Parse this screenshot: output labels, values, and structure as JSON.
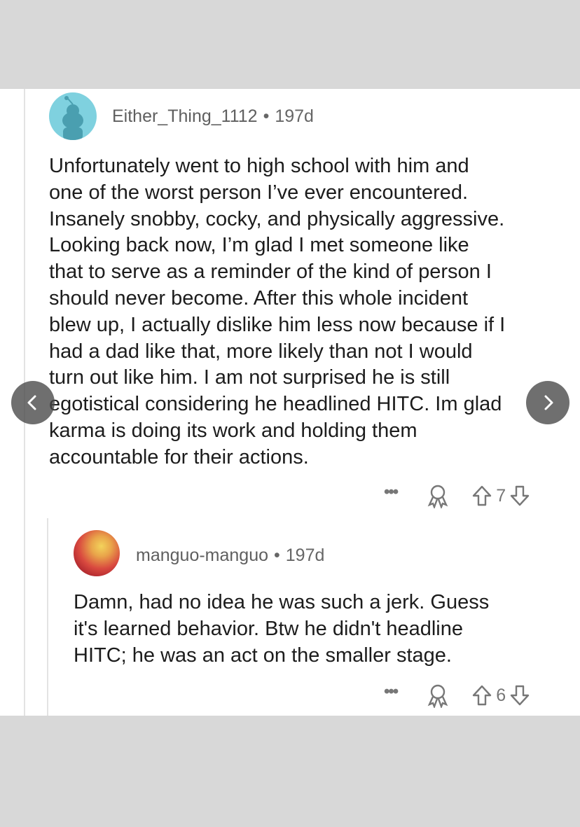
{
  "comments": [
    {
      "username": "Either_Thing_1112",
      "separator": "•",
      "age": "197d",
      "body": "Unfortunately went to high school with him and\none of the worst person I’ve ever encountered.\nInsanely snobby, cocky, and physically aggressive.\nLooking back now, I’m glad I met someone like\nthat to serve as a reminder of the kind of person I\nshould never become. After this whole incident\nblew up, I actually dislike him less now because if I\nhad a dad like that, more likely than not I would\nturn out like him. I am not surprised he is still\negotistical considering he headlined HITC. Im glad\nkarma is doing its work and holding them\naccountable for their actions.",
      "more_label": "•••",
      "votes": "7"
    },
    {
      "username": "manguo-manguo",
      "separator": "•",
      "age": "197d",
      "body": "Damn, had no idea he was such a jerk. Guess\nit's learned behavior. Btw he didn't headline\nHITC; he was an act on the smaller stage.",
      "more_label": "•••",
      "votes": "6"
    }
  ],
  "icons": {
    "avatar_1": "snoo-avatar-icon",
    "avatar_2": "mango-avatar-icon",
    "award": "award-icon",
    "upvote": "upvote-arrow-icon",
    "downvote": "downvote-arrow-icon",
    "prev": "chevron-left-icon",
    "next": "chevron-right-icon"
  },
  "colors": {
    "background": "#d8d8d8",
    "card": "#ffffff",
    "text": "#1c1c1c",
    "meta": "#666666",
    "avatar_1": "#7fd1df"
  }
}
